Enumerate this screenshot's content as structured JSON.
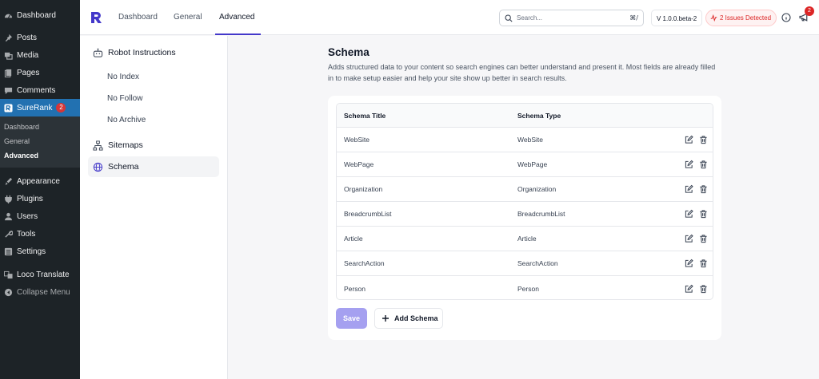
{
  "wp_menu": {
    "items_top": [
      {
        "label": "Dashboard",
        "icon": "dashboard-icon"
      }
    ],
    "items_mid": [
      {
        "label": "Posts",
        "icon": "pin-icon"
      },
      {
        "label": "Media",
        "icon": "media-icon"
      },
      {
        "label": "Pages",
        "icon": "pages-icon"
      },
      {
        "label": "Comments",
        "icon": "comments-icon"
      }
    ],
    "surerank": {
      "label": "SureRank",
      "badge": "2",
      "icon": "surerank-icon"
    },
    "surerank_sub": [
      "Dashboard",
      "General",
      "Advanced"
    ],
    "items_bottom": [
      {
        "label": "Appearance",
        "icon": "appearance-icon"
      },
      {
        "label": "Plugins",
        "icon": "plugins-icon"
      },
      {
        "label": "Users",
        "icon": "users-icon"
      },
      {
        "label": "Tools",
        "icon": "tools-icon"
      },
      {
        "label": "Settings",
        "icon": "settings-icon"
      }
    ],
    "loco": {
      "label": "Loco Translate",
      "icon": "translate-icon"
    },
    "collapse": {
      "label": "Collapse Menu",
      "icon": "collapse-icon"
    }
  },
  "header": {
    "tabs": [
      "Dashboard",
      "General",
      "Advanced"
    ],
    "active_tab": "Advanced",
    "search_placeholder": "Search...",
    "search_shortcut": "⌘/",
    "version": "V 1.0.0.beta-2",
    "issues": "2 Issues Detected",
    "notification_count": "2"
  },
  "sidenav": {
    "robot": "Robot Instructions",
    "robot_sub": [
      "No Index",
      "No Follow",
      "No Archive"
    ],
    "sitemaps": "Sitemaps",
    "schema": "Schema"
  },
  "main": {
    "title": "Schema",
    "description": "Adds structured data to your content so search engines can better understand and present it. Most fields are already filled in to make setup easier and help your site show up better in search results.",
    "table": {
      "headers": [
        "Schema Title",
        "Schema Type"
      ],
      "rows": [
        [
          "WebSite",
          "WebSite"
        ],
        [
          "WebPage",
          "WebPage"
        ],
        [
          "Organization",
          "Organization"
        ],
        [
          "BreadcrumbList",
          "BreadcrumbList"
        ],
        [
          "Article",
          "Article"
        ],
        [
          "SearchAction",
          "SearchAction"
        ],
        [
          "Person",
          "Person"
        ]
      ]
    },
    "save_label": "Save",
    "add_label": "Add Schema"
  },
  "colors": {
    "wp_sidebar": "#1d2327",
    "wp_active": "#2271b1",
    "brand": "#4338ca",
    "save_button": "#a5a0f0",
    "issue_red": "#dc2626"
  }
}
